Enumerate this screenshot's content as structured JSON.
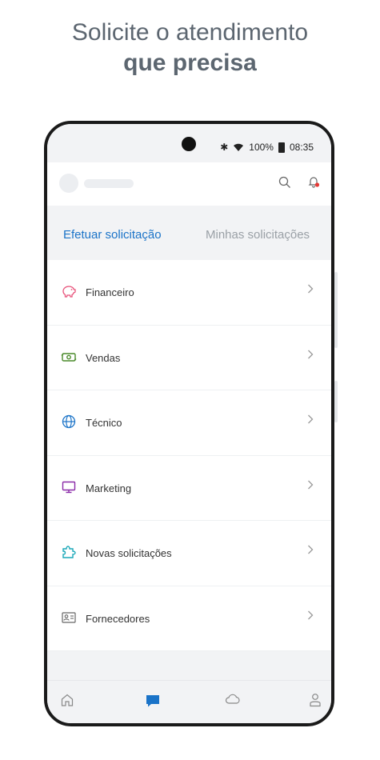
{
  "headline": {
    "line1": "Solicite o atendimento",
    "line2": "que precisa"
  },
  "status_bar": {
    "battery": "100%",
    "time": "08:35",
    "icons": [
      "bluetooth-icon",
      "wifi-icon",
      "battery-icon"
    ]
  },
  "tabs": [
    {
      "label": "Efetuar solicitação",
      "active": true
    },
    {
      "label": "Minhas solicitações",
      "active": false
    }
  ],
  "menu": [
    {
      "label": "Financeiro",
      "icon": "piggy-bank-icon",
      "color": "#e8527a"
    },
    {
      "label": "Vendas",
      "icon": "money-icon",
      "color": "#4a8a2a"
    },
    {
      "label": "Técnico",
      "icon": "globe-icon",
      "color": "#1a73c8"
    },
    {
      "label": "Marketing",
      "icon": "monitor-icon",
      "color": "#8a2aa8"
    },
    {
      "label": "Novas solicitações",
      "icon": "puzzle-icon",
      "color": "#1aa8b8"
    },
    {
      "label": "Fornecedores",
      "icon": "contact-card-icon",
      "color": "#666666"
    }
  ],
  "bottom_nav": [
    {
      "name": "home-icon",
      "active": false
    },
    {
      "name": "chat-icon",
      "active": true
    },
    {
      "name": "cloud-icon",
      "active": false
    },
    {
      "name": "profile-icon",
      "active": false
    }
  ],
  "colors": {
    "accent": "#1a73c8",
    "notification": "#e53935",
    "text": "#333333",
    "muted": "#9aa0a6"
  }
}
